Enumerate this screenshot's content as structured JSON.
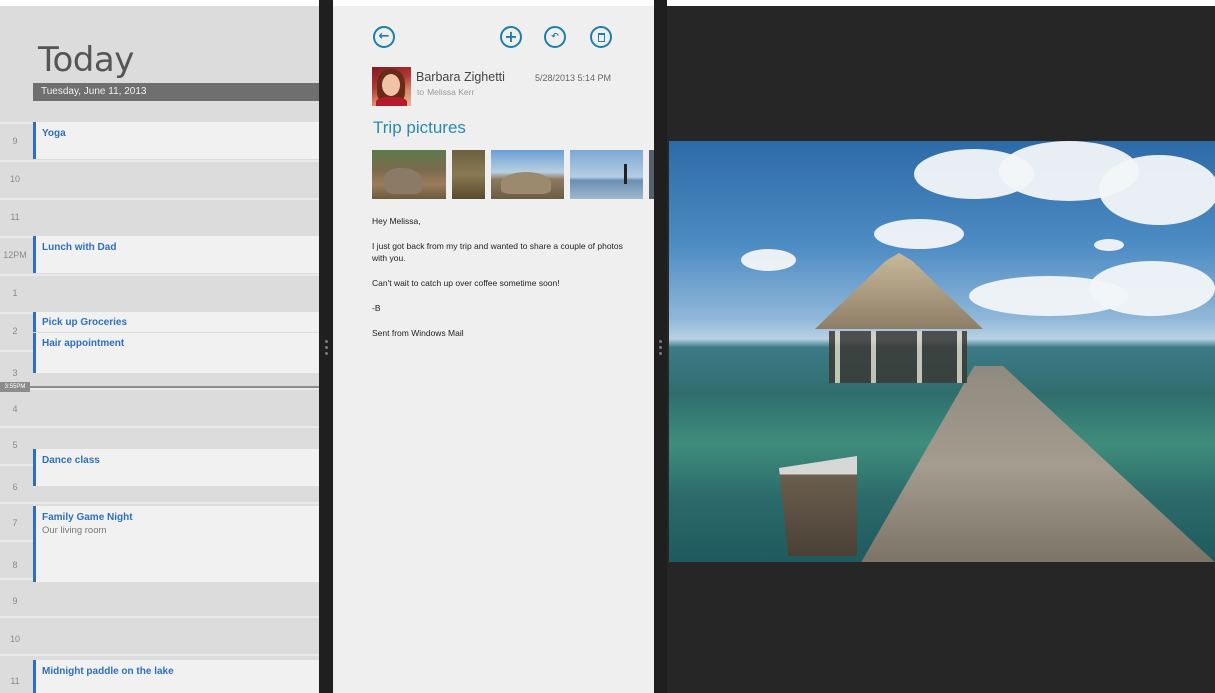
{
  "calendar": {
    "title": "Today",
    "date": "Tuesday, June 11, 2013",
    "hours": [
      "9",
      "10",
      "11",
      "12PM",
      "1",
      "2",
      "3",
      "4",
      "5",
      "6",
      "7",
      "8",
      "9",
      "10",
      "11"
    ],
    "current_time": "3:55PM",
    "events": [
      {
        "title": "Yoga",
        "sub": ""
      },
      {
        "title": "Lunch with Dad",
        "sub": ""
      },
      {
        "title": "Pick up Groceries",
        "sub": ""
      },
      {
        "title": "Hair appointment",
        "sub": ""
      },
      {
        "title": "Dance class",
        "sub": ""
      },
      {
        "title": "Family Game Night",
        "sub": "Our living room"
      },
      {
        "title": "Midnight paddle on the lake",
        "sub": ""
      }
    ],
    "accent": "#2e6fbf"
  },
  "mail": {
    "toolbar": {
      "back_icon": "back-arrow-icon",
      "new_icon": "add-icon",
      "reply_icon": "reply-icon",
      "delete_icon": "delete-icon"
    },
    "sender": "Barbara Zighetti",
    "to_word": "to",
    "recipient": "Melissa Kerr",
    "sent_time": "5/28/2013  5:14 PM",
    "subject": "Trip pictures",
    "body": [
      "Hey Melissa,",
      "I just got back from my trip and wanted to share a couple of photos with you.",
      "Can't wait to catch up over coffee sometime soon!",
      "-B",
      "Sent from Windows Mail"
    ],
    "accent": "#2a8ab0"
  },
  "photo": {
    "icon": "pier-photo-image"
  }
}
